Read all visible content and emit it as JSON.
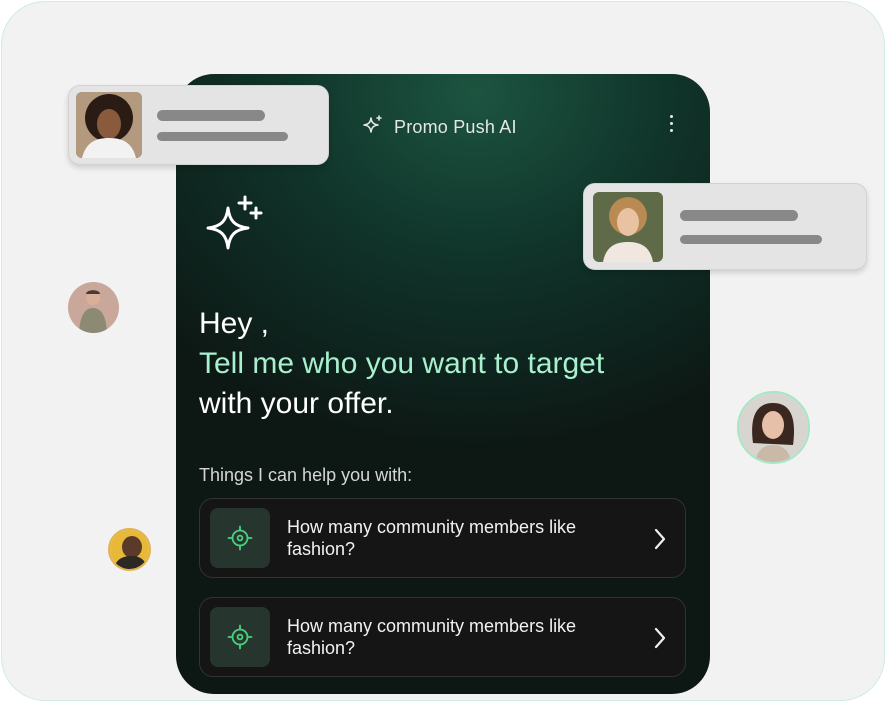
{
  "app": {
    "title": "Promo Push AI"
  },
  "greeting": {
    "line1": "Hey ,",
    "line2": "Tell me who you want to target",
    "line3": "with your offer."
  },
  "help": {
    "heading": "Things I can help you with:",
    "options": [
      {
        "text": "How many community members like fashion?"
      },
      {
        "text": "How many community members like fashion?"
      }
    ]
  },
  "colors": {
    "accent_text": "#a9f0cf",
    "phone_bg": "#0d1714",
    "target_icon": "#49d07f"
  },
  "icons": {
    "header": "sparkle-icon",
    "hero": "sparkles-plus-icon",
    "option": "target-icon",
    "chevron": "chevron-right-icon",
    "menu": "kebab-menu-icon"
  }
}
